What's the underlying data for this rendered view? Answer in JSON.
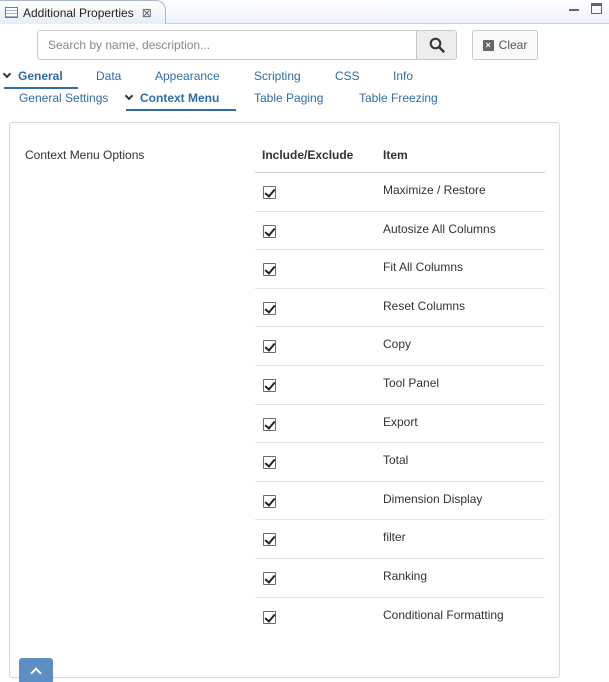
{
  "window": {
    "tab_title": "Additional Properties",
    "tab_close": "⊠"
  },
  "search": {
    "placeholder": "Search by name, description...",
    "value": "",
    "clear_label": "Clear"
  },
  "tabs_primary": [
    {
      "label": "General",
      "active": true
    },
    {
      "label": "Data",
      "active": false
    },
    {
      "label": "Appearance",
      "active": false
    },
    {
      "label": "Scripting",
      "active": false
    },
    {
      "label": "CSS",
      "active": false
    },
    {
      "label": "Info",
      "active": false
    }
  ],
  "tabs_secondary": [
    {
      "label": "General Settings",
      "active": false
    },
    {
      "label": "Context Menu",
      "active": true
    },
    {
      "label": "Table Paging",
      "active": false
    },
    {
      "label": "Table Freezing",
      "active": false
    }
  ],
  "context_menu": {
    "section_label": "Context Menu Options",
    "col_include": "Include/Exclude",
    "col_item": "Item",
    "items": [
      {
        "label": "Maximize / Restore",
        "checked": true
      },
      {
        "label": "Autosize All Columns",
        "checked": true
      },
      {
        "label": "Fit All Columns",
        "checked": true
      },
      {
        "label": "Reset Columns",
        "checked": true
      },
      {
        "label": "Copy",
        "checked": true
      },
      {
        "label": "Tool Panel",
        "checked": true
      },
      {
        "label": "Export",
        "checked": true
      },
      {
        "label": "Total",
        "checked": true
      },
      {
        "label": "Dimension Display",
        "checked": true
      },
      {
        "label": "filter",
        "checked": true
      },
      {
        "label": "Ranking",
        "checked": true
      },
      {
        "label": "Conditional Formatting",
        "checked": true
      }
    ]
  },
  "colors": {
    "accent": "#2f6ea5",
    "scroll_button": "#5d8fc4"
  }
}
